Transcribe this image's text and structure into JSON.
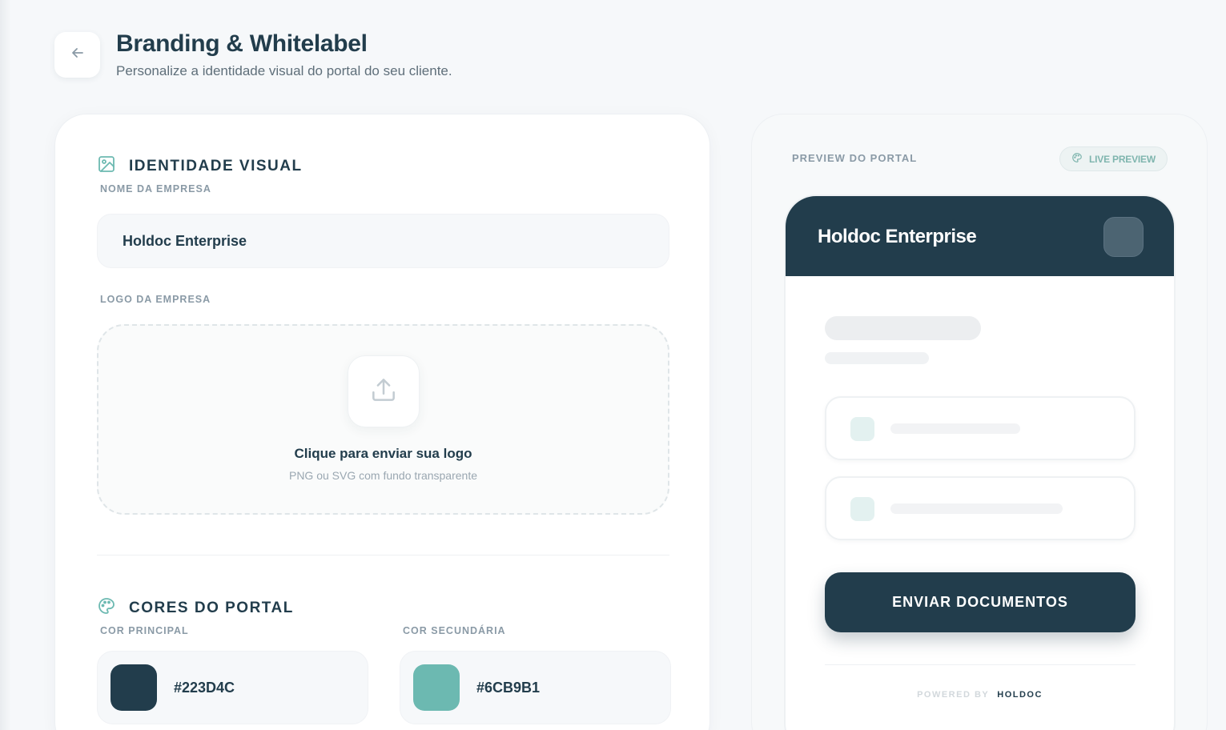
{
  "header": {
    "title": "Branding & Whitelabel",
    "subtitle": "Personalize a identidade visual do portal do seu cliente."
  },
  "identity": {
    "section_title": "IDENTIDADE VISUAL",
    "company_name_label": "NOME DA EMPRESA",
    "company_name_value": "Holdoc Enterprise",
    "logo_label": "LOGO DA EMPRESA",
    "upload_title": "Clique para enviar sua logo",
    "upload_hint": "PNG ou SVG com fundo transparente"
  },
  "colors": {
    "section_title": "CORES DO PORTAL",
    "primary_label": "COR PRINCIPAL",
    "primary_value": "#223D4C",
    "secondary_label": "COR SECUNDÁRIA",
    "secondary_value": "#6CB9B1"
  },
  "preview": {
    "label": "PREVIEW DO PORTAL",
    "badge": "LIVE PREVIEW",
    "portal_title": "Holdoc Enterprise",
    "cta": "ENVIAR DOCUMENTOS",
    "powered_by": "POWERED BY",
    "powered_brand": "HOLDOC"
  },
  "icons": {
    "back": "arrow-left-icon",
    "identity": "image-icon",
    "upload": "upload-icon",
    "colors": "palette-icon",
    "badge": "palette-icon"
  },
  "theme": {
    "primary": "#223D4C",
    "secondary": "#6CB9B1"
  }
}
